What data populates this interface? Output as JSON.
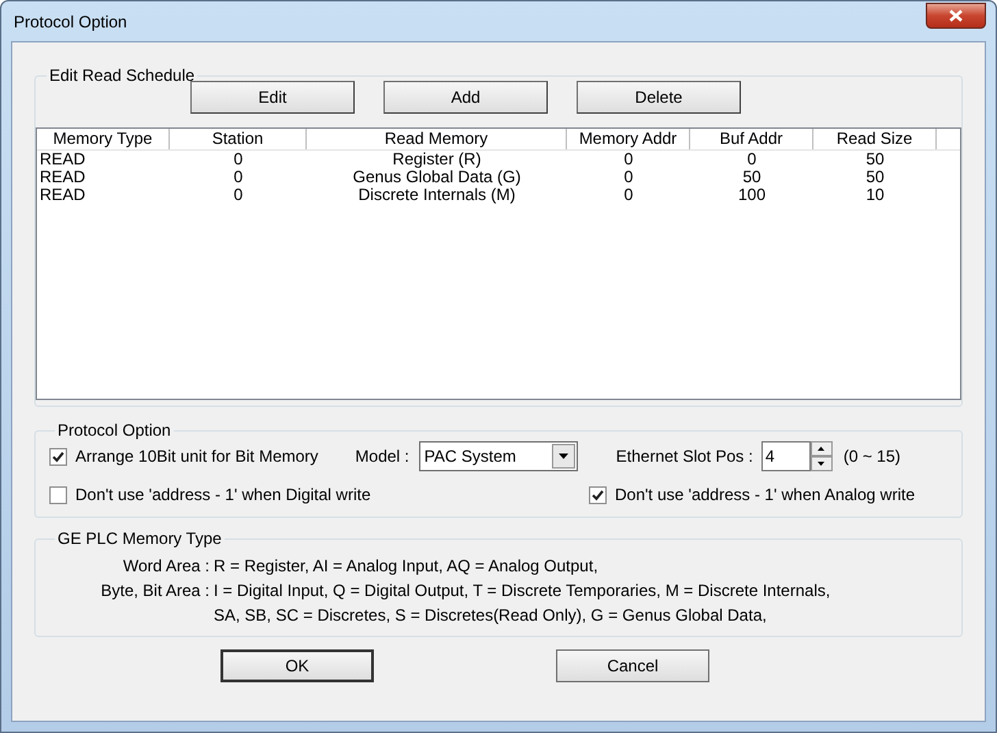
{
  "window": {
    "title": "Protocol Option"
  },
  "schedule": {
    "title": "Edit Read Schedule",
    "buttons": [
      "Edit",
      "Add",
      "Delete"
    ],
    "columns": [
      "Memory Type",
      "Station",
      "Read Memory",
      "Memory Addr",
      "Buf Addr",
      "Read Size"
    ],
    "rows": [
      [
        "READ",
        "0",
        "Register (R)",
        "0",
        "0",
        "50"
      ],
      [
        "READ",
        "0",
        "Genus Global Data (G)",
        "0",
        "50",
        "50"
      ],
      [
        "READ",
        "0",
        "Discrete Internals (M)",
        "0",
        "100",
        "10"
      ]
    ]
  },
  "protocol": {
    "title": "Protocol Option",
    "arrange": {
      "label": "Arrange 10Bit unit for Bit Memory",
      "checked": true
    },
    "model": {
      "label": "Model :",
      "value": "PAC System"
    },
    "slot": {
      "label": "Ethernet Slot Pos :",
      "value": "4",
      "range": "(0 ~ 15)"
    },
    "digital": {
      "label": "Don't use 'address - 1' when Digital write",
      "checked": false
    },
    "analog": {
      "label": "Don't use 'address - 1' when Analog write",
      "checked": true
    }
  },
  "memory_type": {
    "title": "GE PLC Memory Type",
    "lines": [
      {
        "label": "Word Area :",
        "text": "R = Register, AI = Analog Input, AQ = Analog Output,"
      },
      {
        "label": "Byte, Bit Area :",
        "text": "I = Digital Input, Q = Digital Output,  T = Discrete Temporaries, M = Discrete Internals,"
      },
      {
        "text": "SA, SB, SC = Discretes,  S = Discretes(Read Only),  G = Genus Global Data,"
      }
    ]
  },
  "buttons": [
    "OK",
    "Cancel"
  ]
}
